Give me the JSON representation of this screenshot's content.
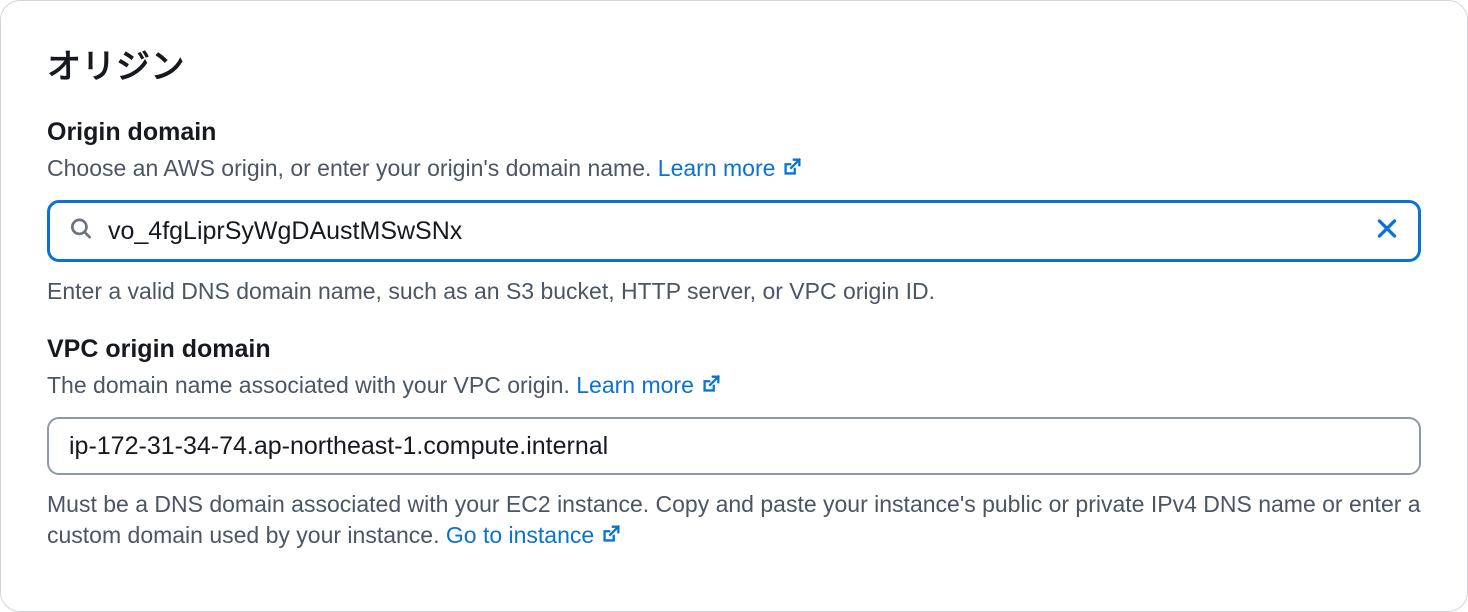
{
  "panel": {
    "title": "オリジン"
  },
  "origin_domain": {
    "label": "Origin domain",
    "hint_prefix": "Choose an AWS origin, or enter your origin's domain name. ",
    "learn_more": "Learn more",
    "value": "vo_4fgLiprSyWgDAustMSwSNx",
    "footer": "Enter a valid DNS domain name, such as an S3 bucket, HTTP server, or VPC origin ID."
  },
  "vpc_origin": {
    "label": "VPC origin domain",
    "hint_prefix": "The domain name associated with your VPC origin. ",
    "learn_more": "Learn more",
    "value": "ip-172-31-34-74.ap-northeast-1.compute.internal",
    "footer_prefix": "Must be a DNS domain associated with your EC2 instance. Copy and paste your instance's public or private IPv4 DNS name or enter a custom domain used by your instance. ",
    "go_to_instance": "Go to instance"
  }
}
